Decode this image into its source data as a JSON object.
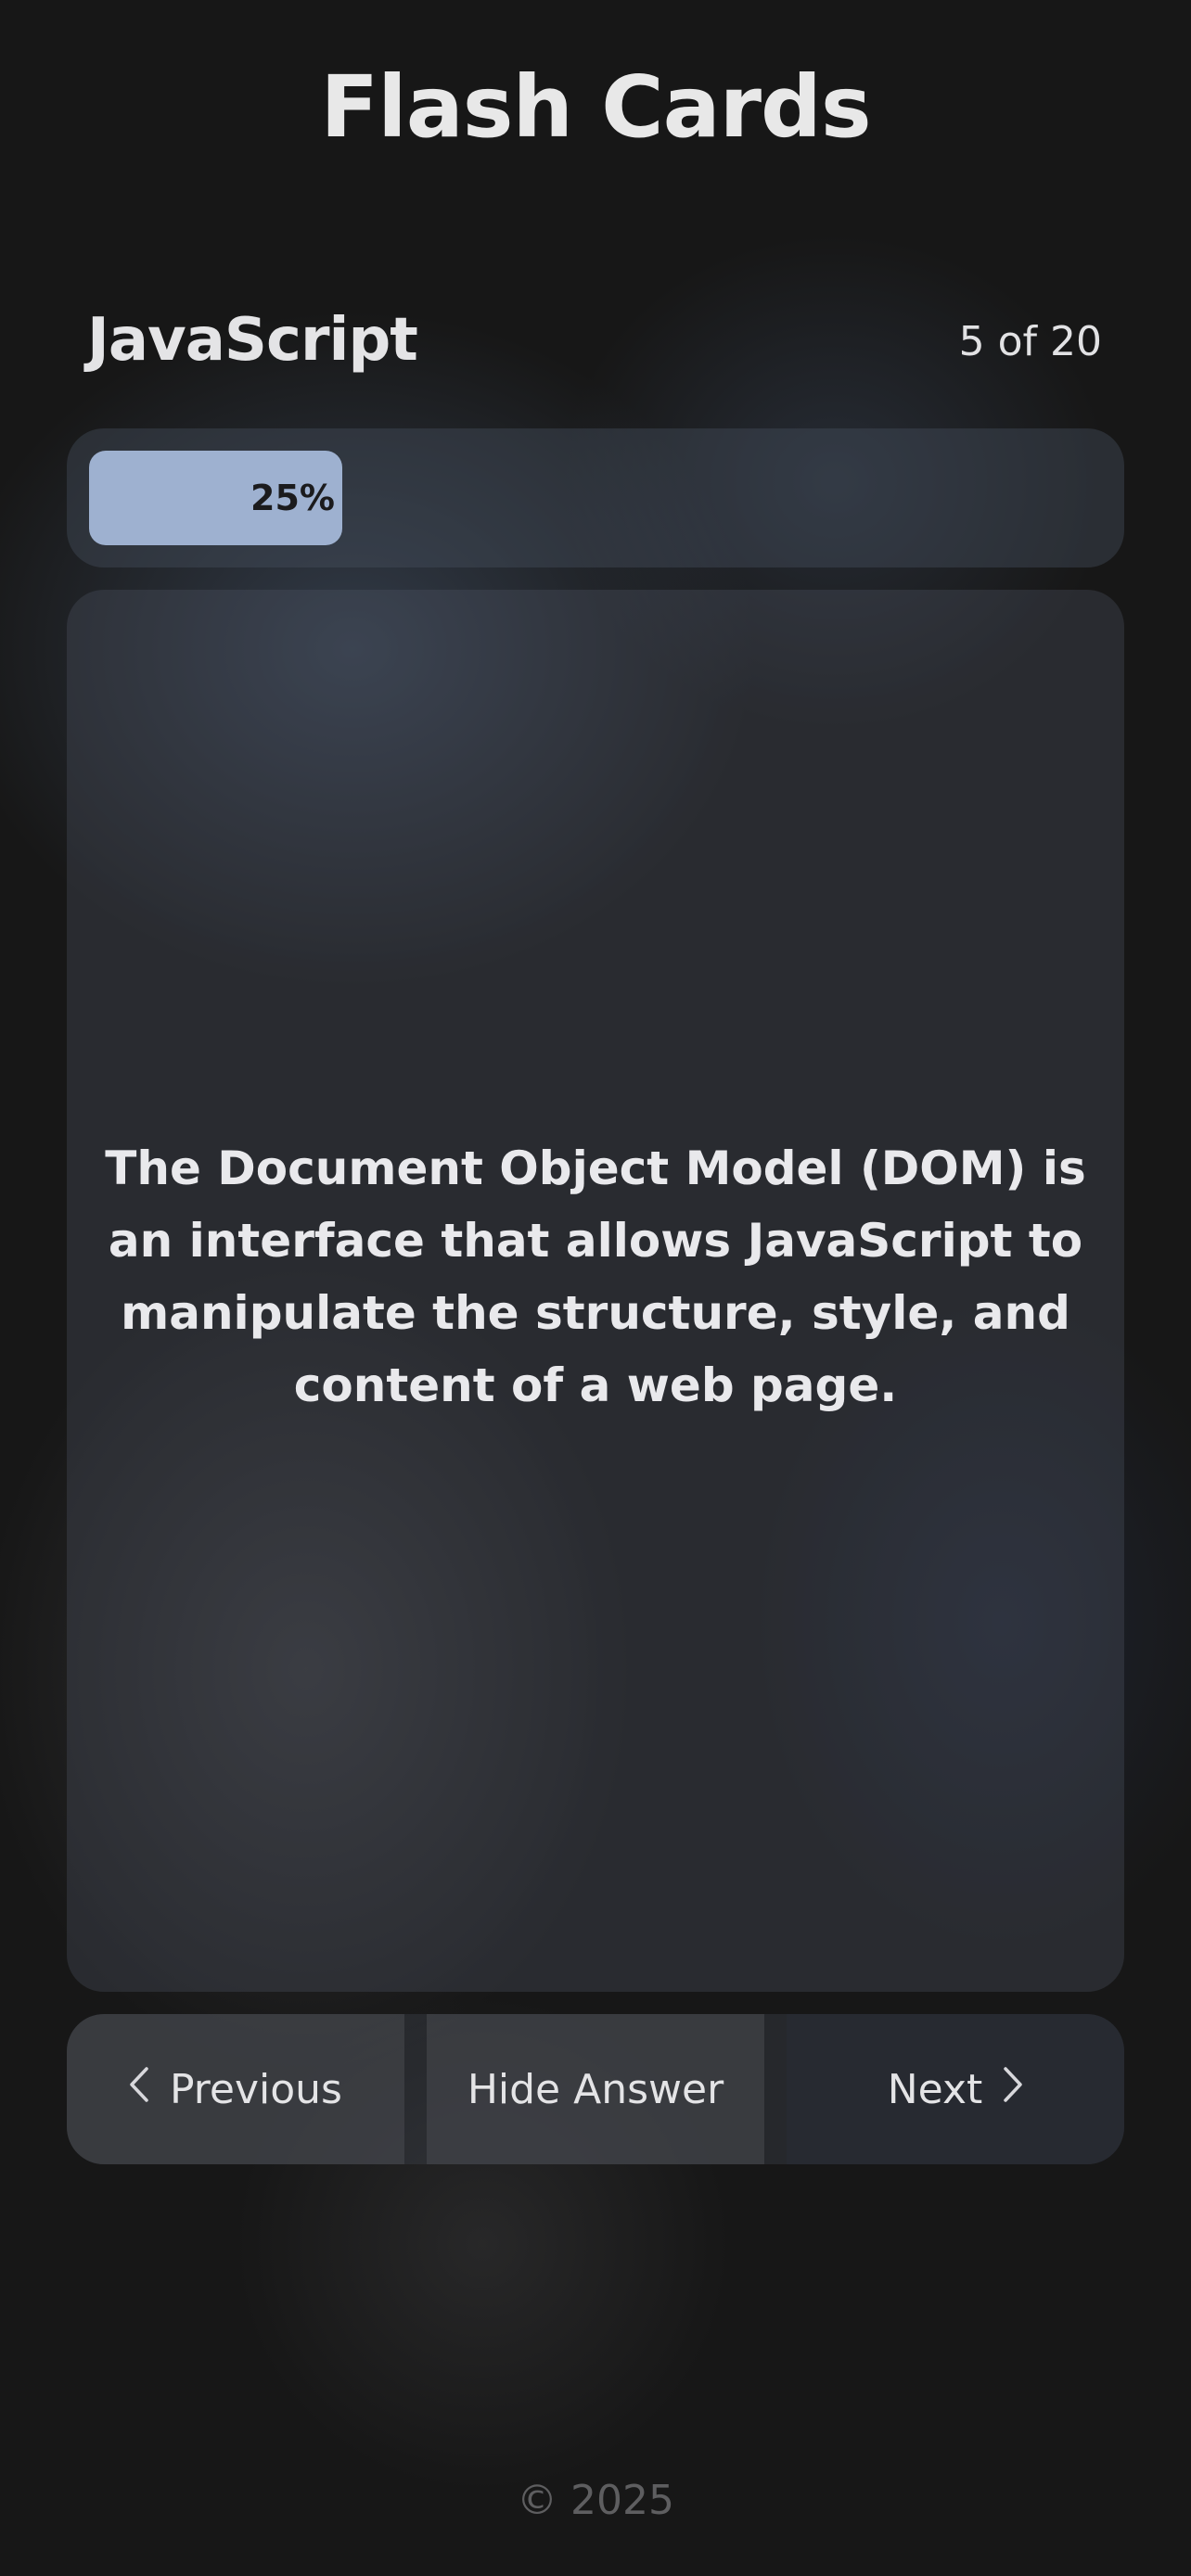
{
  "app": {
    "title": "Flash Cards"
  },
  "deck": {
    "name": "JavaScript",
    "counter": "5 of 20"
  },
  "progress": {
    "percent": 25,
    "label": "25%",
    "color": "#9eb1d0"
  },
  "card": {
    "text": "The Document Object Model (DOM) is an interface that allows JavaScript to manipulate the structure, style, and content of a web page."
  },
  "controls": {
    "previous_label": "Previous",
    "previous_icon": "chevron-left-icon",
    "toggle_label": "Hide Answer",
    "next_label": "Next",
    "next_icon": "chevron-right-icon"
  },
  "footer": {
    "text": "© 2025"
  }
}
